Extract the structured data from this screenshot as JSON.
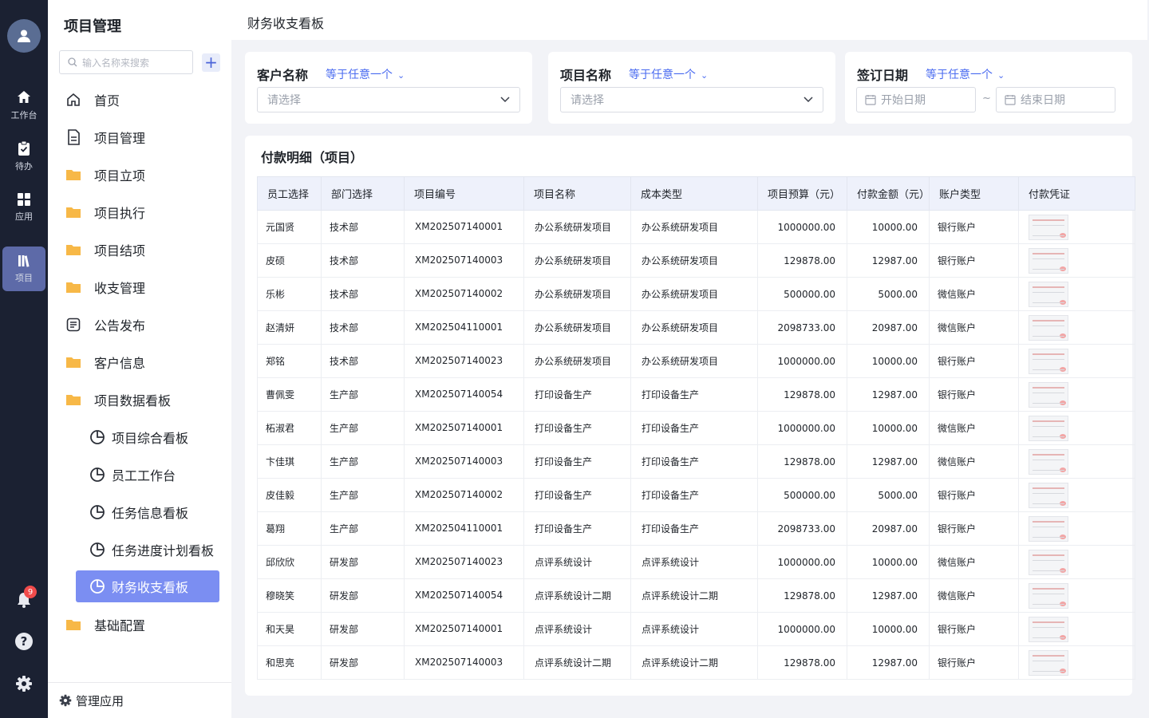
{
  "rail": {
    "items": [
      {
        "label": "工作台",
        "icon": "home-icon"
      },
      {
        "label": "待办",
        "icon": "clipboard-check-icon"
      },
      {
        "label": "应用",
        "icon": "apps-grid-icon"
      },
      {
        "label": "项目",
        "icon": "books-icon"
      }
    ],
    "notification_count": "9"
  },
  "sidebar": {
    "title": "项目管理",
    "search_placeholder": "输入名称来搜索",
    "items": [
      {
        "label": "首页",
        "icon": "home-outline-icon"
      },
      {
        "label": "项目管理",
        "icon": "document-icon"
      },
      {
        "label": "项目立项",
        "icon": "folder-icon"
      },
      {
        "label": "项目执行",
        "icon": "folder-icon"
      },
      {
        "label": "项目结项",
        "icon": "folder-icon"
      },
      {
        "label": "收支管理",
        "icon": "folder-icon"
      },
      {
        "label": "公告发布",
        "icon": "notice-icon"
      },
      {
        "label": "客户信息",
        "icon": "folder-icon"
      },
      {
        "label": "项目数据看板",
        "icon": "folder-icon"
      }
    ],
    "sub_items": [
      {
        "label": "项目综合看板"
      },
      {
        "label": "员工工作台"
      },
      {
        "label": "任务信息看板"
      },
      {
        "label": "任务进度计划看板"
      },
      {
        "label": "财务收支看板"
      }
    ],
    "last_item": {
      "label": "基础配置"
    },
    "footer_label": "管理应用"
  },
  "header": {
    "title": "财务收支看板"
  },
  "filters": [
    {
      "label": "客户名称",
      "operator": "等于任意一个",
      "placeholder": "请选择"
    },
    {
      "label": "项目名称",
      "operator": "等于任意一个",
      "placeholder": "请选择"
    },
    {
      "label": "签订日期",
      "operator": "等于任意一个",
      "start_placeholder": "开始日期",
      "end_placeholder": "结束日期",
      "separator": "~"
    }
  ],
  "table": {
    "title": "付款明细（项目）",
    "columns": [
      "员工选择",
      "部门选择",
      "项目编号",
      "项目名称",
      "成本类型",
      "项目预算（元）",
      "付款金额（元）",
      "账户类型",
      "付款凭证"
    ],
    "rows": [
      [
        "元国贤",
        "技术部",
        "XM202507140001",
        "办公系统研发项目",
        "办公系统研发项目",
        "1000000.00",
        "10000.00",
        "银行账户"
      ],
      [
        "皮硕",
        "技术部",
        "XM202507140003",
        "办公系统研发项目",
        "办公系统研发项目",
        "129878.00",
        "12987.00",
        "银行账户"
      ],
      [
        "乐彬",
        "技术部",
        "XM202507140002",
        "办公系统研发项目",
        "办公系统研发项目",
        "500000.00",
        "5000.00",
        "微信账户"
      ],
      [
        "赵清妍",
        "技术部",
        "XM202504110001",
        "办公系统研发项目",
        "办公系统研发项目",
        "2098733.00",
        "20987.00",
        "微信账户"
      ],
      [
        "郑铭",
        "技术部",
        "XM202507140023",
        "办公系统研发项目",
        "办公系统研发项目",
        "1000000.00",
        "10000.00",
        "银行账户"
      ],
      [
        "曹佩雯",
        "生产部",
        "XM202507140054",
        "打印设备生产",
        "打印设备生产",
        "129878.00",
        "12987.00",
        "银行账户"
      ],
      [
        "柘淑君",
        "生产部",
        "XM202507140001",
        "打印设备生产",
        "打印设备生产",
        "1000000.00",
        "10000.00",
        "微信账户"
      ],
      [
        "卞佳琪",
        "生产部",
        "XM202507140003",
        "打印设备生产",
        "打印设备生产",
        "129878.00",
        "12987.00",
        "微信账户"
      ],
      [
        "皮佳毅",
        "生产部",
        "XM202507140002",
        "打印设备生产",
        "打印设备生产",
        "500000.00",
        "5000.00",
        "银行账户"
      ],
      [
        "葛翔",
        "生产部",
        "XM202504110001",
        "打印设备生产",
        "打印设备生产",
        "2098733.00",
        "20987.00",
        "银行账户"
      ],
      [
        "邱欣欣",
        "研发部",
        "XM202507140023",
        "点评系统设计",
        "点评系统设计",
        "1000000.00",
        "10000.00",
        "微信账户"
      ],
      [
        "穆晓笑",
        "研发部",
        "XM202507140054",
        "点评系统设计二期",
        "点评系统设计二期",
        "129878.00",
        "12987.00",
        "微信账户"
      ],
      [
        "和天昊",
        "研发部",
        "XM202507140001",
        "点评系统设计",
        "点评系统设计",
        "1000000.00",
        "10000.00",
        "银行账户"
      ],
      [
        "和思亮",
        "研发部",
        "XM202507140003",
        "点评系统设计二期",
        "点评系统设计二期",
        "129878.00",
        "12987.00",
        "银行账户"
      ]
    ]
  },
  "colors": {
    "rail_bg": "#1b2132",
    "accent": "#4a6bf0",
    "active_sub": "#7b8ef2",
    "header_row": "#eef1fb"
  }
}
